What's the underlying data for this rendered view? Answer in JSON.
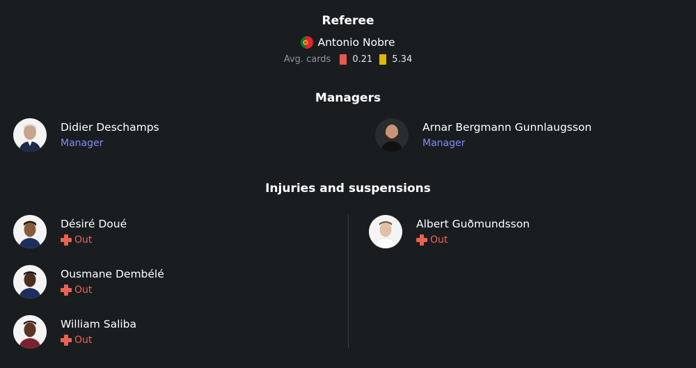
{
  "referee": {
    "title": "Referee",
    "name": "Antonio Nobre",
    "flag_icon": "portugal-flag-icon",
    "avg_cards_label": "Avg. cards",
    "red_cards": "0.21",
    "yellow_cards": "5.34"
  },
  "managers": {
    "title": "Managers",
    "home": {
      "name": "Didier Deschamps",
      "role": "Manager"
    },
    "away": {
      "name": "Arnar Bergmann Gunnlaugsson",
      "role": "Manager"
    }
  },
  "injuries": {
    "title": "Injuries and suspensions",
    "home": [
      {
        "name": "Désiré Doué",
        "status": "Out"
      },
      {
        "name": "Ousmane Dembélé",
        "status": "Out"
      },
      {
        "name": "William Saliba",
        "status": "Out"
      }
    ],
    "away": [
      {
        "name": "Albert Guðmundsson",
        "status": "Out"
      }
    ]
  },
  "colors": {
    "background": "#1a1d20",
    "accent_role": "#7f8cf5",
    "status_out": "#ea6352",
    "red_card": "#e8584d",
    "yellow_card": "#e2b706"
  }
}
